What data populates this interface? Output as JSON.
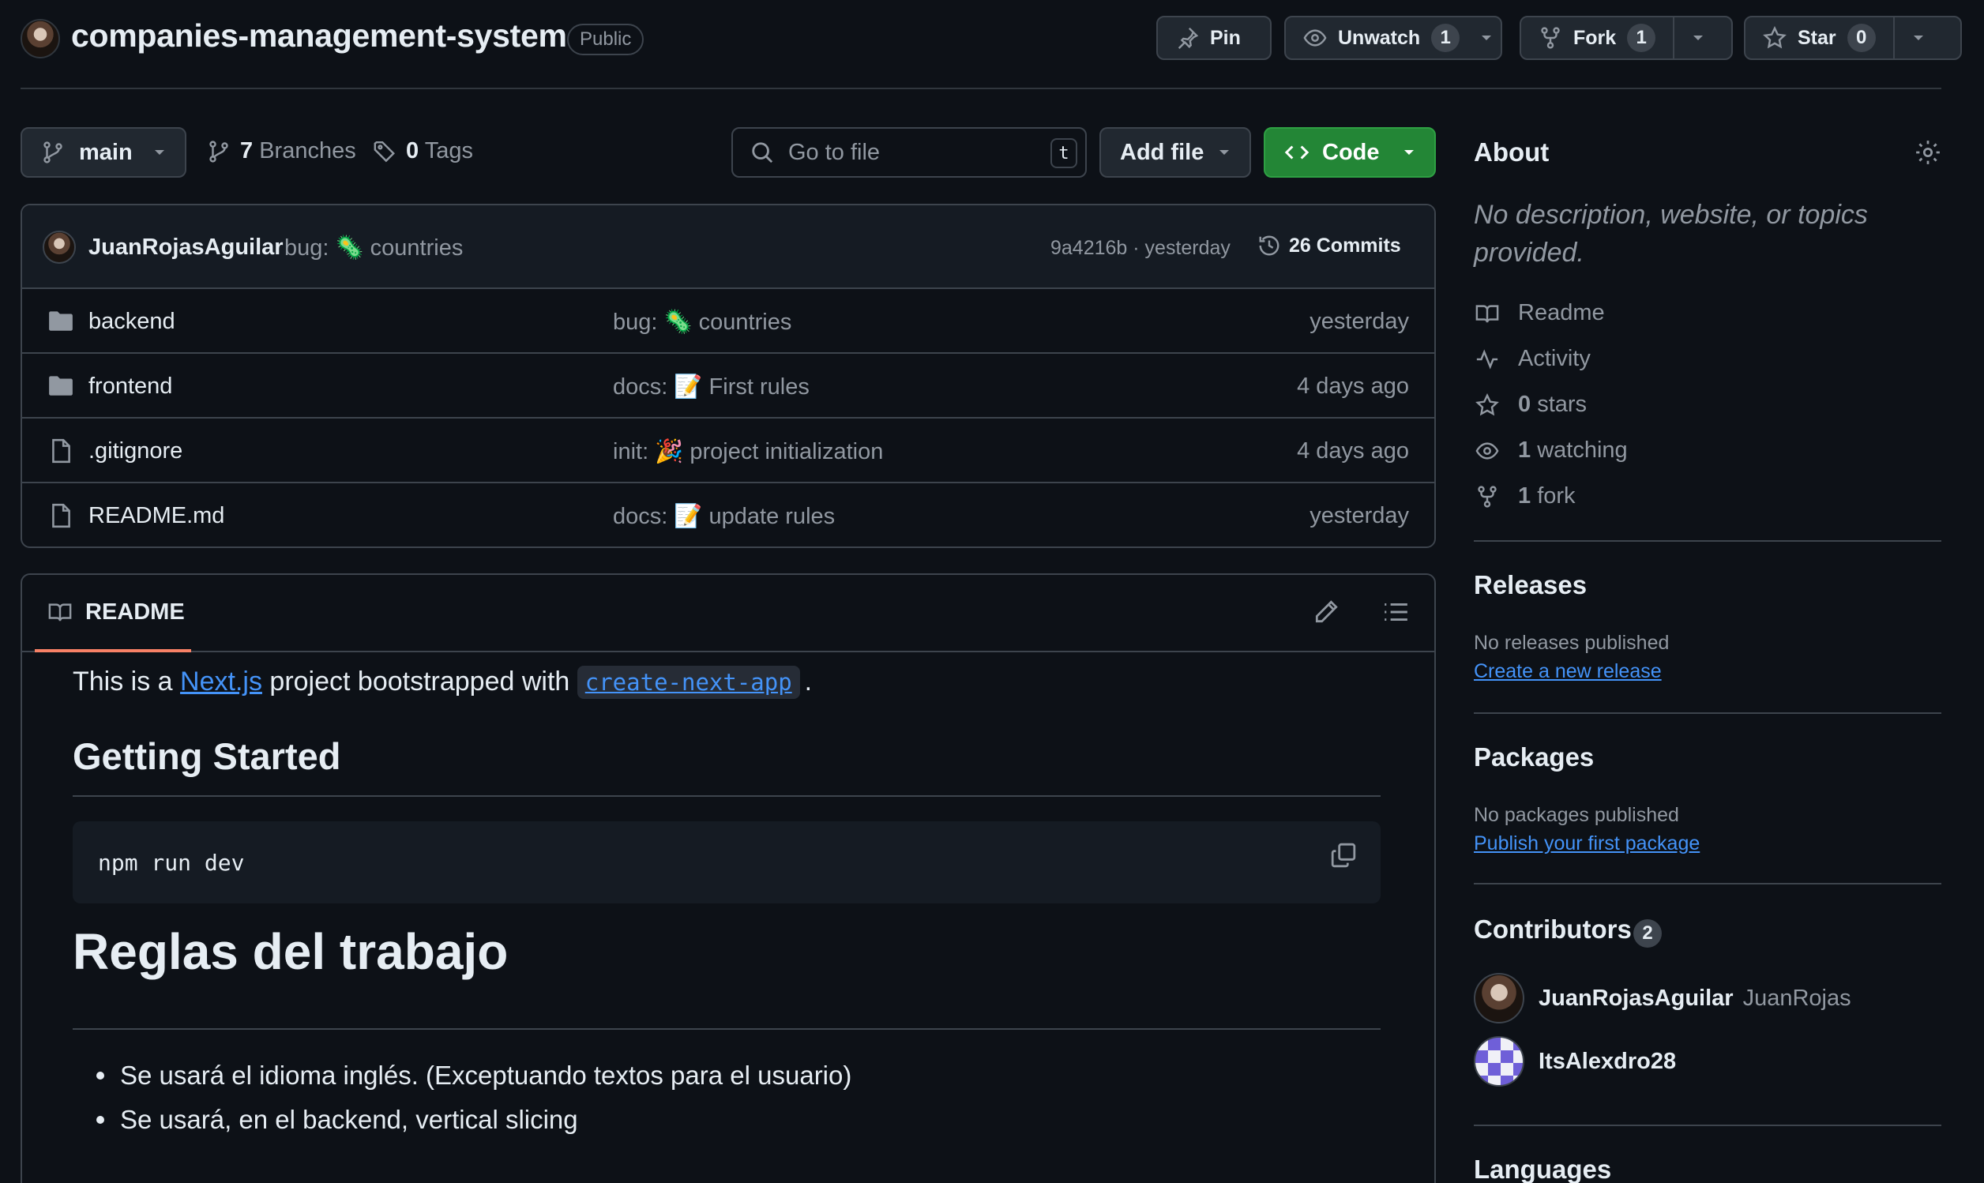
{
  "repo": {
    "name": "companies-management-system",
    "visibility": "Public",
    "pin_label": "Pin",
    "unwatch_label": "Unwatch",
    "watch_count": "1",
    "fork_label": "Fork",
    "fork_count": "1",
    "star_label": "Star",
    "star_count": "0"
  },
  "file_nav": {
    "branch": "main",
    "branches_count": "7",
    "branches_label": "Branches",
    "tags_count": "0",
    "tags_label": "Tags",
    "goto_placeholder": "Go to file",
    "goto_shortcut": "t",
    "add_file_label": "Add file",
    "code_label": "Code"
  },
  "latest_commit": {
    "author": "JuanRojasAguilar",
    "message": "bug: 🦠 countries",
    "meta": "9a4216b · yesterday",
    "commits_label": "26 Commits"
  },
  "files": [
    {
      "type": "folder",
      "name": "backend",
      "message": "bug: 🦠 countries",
      "time": "yesterday"
    },
    {
      "type": "folder",
      "name": "frontend",
      "message": "docs: 📝 First rules",
      "time": "4 days ago"
    },
    {
      "type": "file",
      "name": ".gitignore",
      "message": "init: 🎉 project initialization",
      "time": "4 days ago"
    },
    {
      "type": "file",
      "name": "README.md",
      "message": "docs: 📝 update rules",
      "time": "yesterday"
    }
  ],
  "readme": {
    "tab_label": "README",
    "intro_prefix": "This is a ",
    "intro_link": "Next.js",
    "intro_middle": " project bootstrapped with ",
    "intro_code": "create-next-app",
    "intro_suffix": ".",
    "h_getting_started": "Getting Started",
    "code_block": "npm run dev",
    "h_rules": "Reglas del trabajo",
    "rules": [
      "Se usará el idioma inglés. (Exceptuando textos para el usuario)",
      "Se usará, en el backend, vertical slicing"
    ]
  },
  "sidebar": {
    "about_title": "About",
    "about_desc": "No description, website, or topics provided.",
    "meta": [
      {
        "icon": "book-icon",
        "strong": "",
        "label": "Readme"
      },
      {
        "icon": "pulse-icon",
        "strong": "",
        "label": "Activity"
      },
      {
        "icon": "star-icon",
        "strong": "0",
        "label": "stars"
      },
      {
        "icon": "eye-icon",
        "strong": "1",
        "label": "watching"
      },
      {
        "icon": "fork-icon",
        "strong": "1",
        "label": "fork"
      }
    ],
    "releases_title": "Releases",
    "releases_note": "No releases published",
    "releases_link": "Create a new release",
    "packages_title": "Packages",
    "packages_note": "No packages published",
    "packages_link": "Publish your first package",
    "contributors_title": "Contributors",
    "contributors_count": "2",
    "contributors": [
      {
        "login": "JuanRojasAguilar",
        "name": "JuanRojas"
      },
      {
        "login": "ItsAlexdro28",
        "name": ""
      }
    ],
    "languages_title": "Languages"
  },
  "colors": {
    "background": "#0d1117",
    "border": "#3d444d",
    "text": "#e6edf3",
    "muted": "#9198a1",
    "link": "#4493f8",
    "code_button": "#238636",
    "tab_underline": "#f78166"
  }
}
